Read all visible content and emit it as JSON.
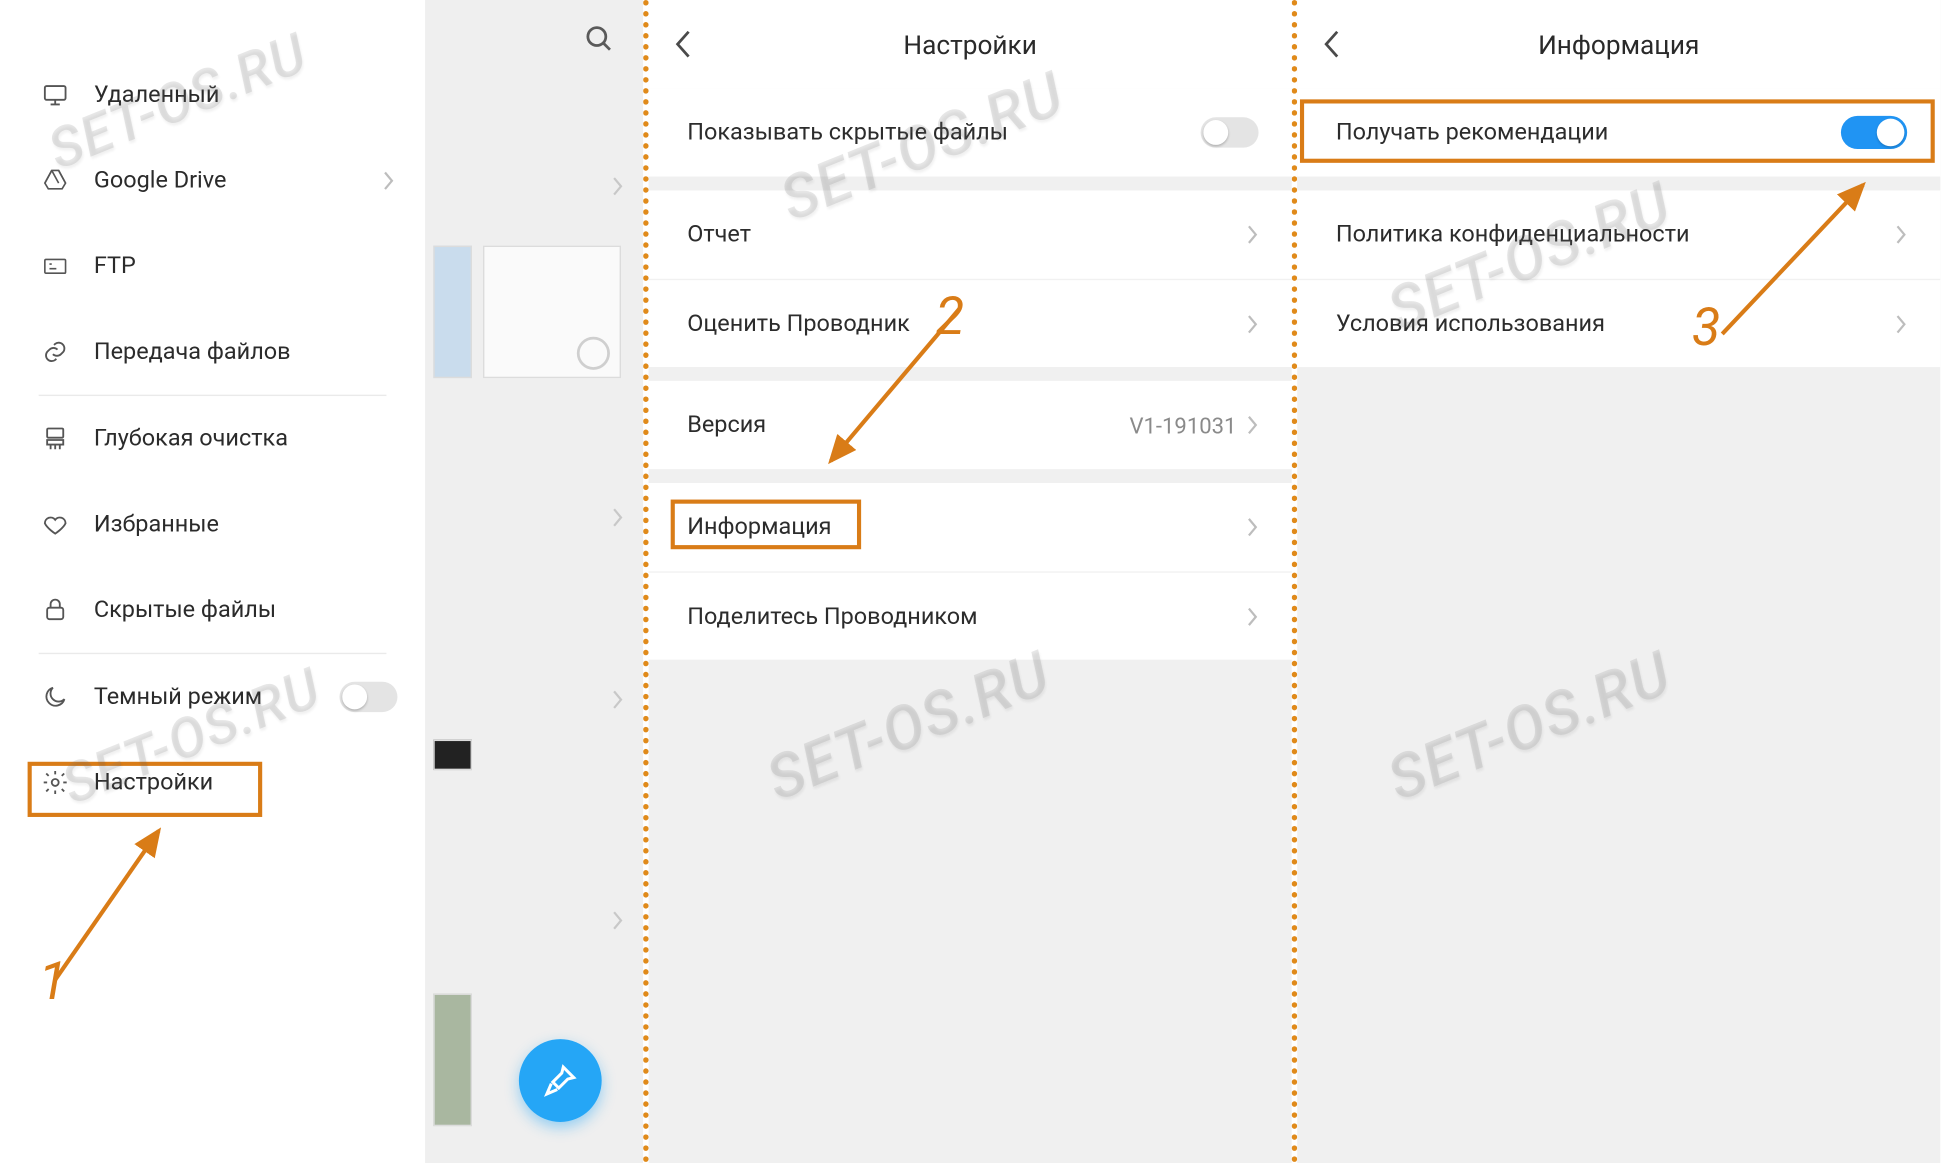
{
  "watermark_text": "SET-OS.RU",
  "panel1": {
    "drawer_items": [
      {
        "icon": "monitor-icon",
        "label": "Удаленный",
        "chev": false
      },
      {
        "icon": "gdrive-icon",
        "label": "Google Drive",
        "chev": true
      },
      {
        "icon": "ftp-icon",
        "label": "FTP",
        "chev": false
      },
      {
        "icon": "link-icon",
        "label": "Передача файлов",
        "chev": false
      },
      {
        "icon": "broom-icon",
        "label": "Глубокая очистка",
        "chev": false
      },
      {
        "icon": "heart-icon",
        "label": "Избранные",
        "chev": false
      },
      {
        "icon": "lock-icon",
        "label": "Скрытые файлы",
        "chev": false
      },
      {
        "icon": "moon-icon",
        "label": "Темный режим",
        "chev": false,
        "toggle_off": true
      },
      {
        "icon": "gear-icon",
        "label": "Настройки",
        "chev": false,
        "highlighted": true
      }
    ],
    "annotation_number": "1"
  },
  "panel2": {
    "title": "Настройки",
    "rows": [
      {
        "kind": "toggle_off",
        "label": "Показывать скрытые файлы"
      },
      {
        "kind": "gap"
      },
      {
        "kind": "nav",
        "label": "Отчет"
      },
      {
        "kind": "nav",
        "label": "Оценить Проводник"
      },
      {
        "kind": "gap"
      },
      {
        "kind": "value",
        "label": "Версия",
        "value": "V1-191031"
      },
      {
        "kind": "gap"
      },
      {
        "kind": "nav",
        "label": "Информация",
        "highlighted": true
      },
      {
        "kind": "nav",
        "label": "Поделитесь Проводником"
      }
    ],
    "annotation_number": "2"
  },
  "panel3": {
    "title": "Информация",
    "rows": [
      {
        "kind": "toggle_on",
        "label": "Получать рекомендации",
        "highlighted": true
      },
      {
        "kind": "gap"
      },
      {
        "kind": "nav",
        "label": "Политика конфиденциальности"
      },
      {
        "kind": "nav",
        "label": "Условия использования"
      }
    ],
    "annotation_number": "3"
  }
}
